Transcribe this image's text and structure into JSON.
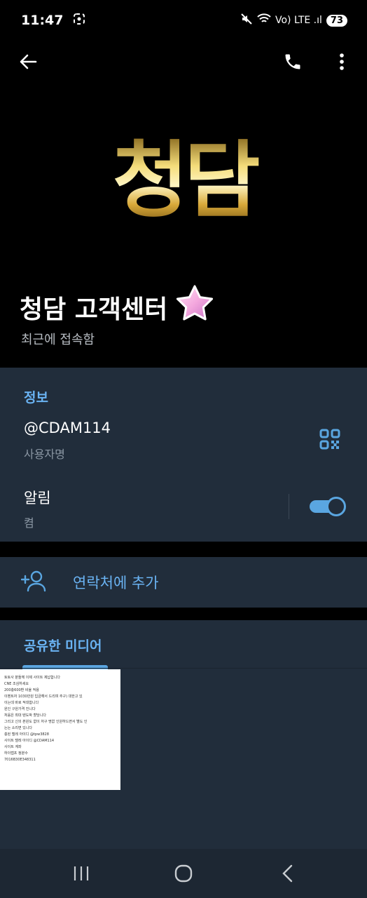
{
  "status_bar": {
    "time": "11:47",
    "network": "Vo) LTE .ıl",
    "battery": "73"
  },
  "icons": {
    "back": "arrow-left-icon",
    "call": "phone-icon",
    "menu": "more-vertical-icon",
    "fab": "message-icon",
    "qr": "qr-code-icon",
    "add_contact": "person-add-icon"
  },
  "hero": {
    "logo_text": "청담"
  },
  "profile": {
    "name": "청담 고객센터",
    "status": "최근에 접속함"
  },
  "info": {
    "title": "정보",
    "username": "@CDAM114",
    "username_caption": "사용자명",
    "notifications_label": "알림",
    "notifications_value": "켬",
    "notifications_on": true
  },
  "add_contact": {
    "label": "연락처에 추가"
  },
  "media": {
    "title": "공유한 미디어",
    "thumbnail_lines": [
      "토토사 분들께 이제 사이트 제납합니다",
      "CNE 조심하세요",
      "200충600환 비율 적용",
      "이벤트자 1030만원 입금해서 드리며 추구) 대한고 있",
      "이는데 바로 적대합니다",
      "원인 구원가격 진니다",
      "처음은 최대 텐도박 할당니다",
      "그리고 신의 본원도 없이 처구 명없 인원하드면서 별도 인",
      "는는 소리면 있니다",
      "충된 텔레 아이디 @tpw3828",
      "사이트 텔레 아이디 @CDAM114",
      "사이트 계좌",
      "하이랩프 정분수",
      "7016B30E348311"
    ]
  },
  "colors": {
    "accent": "#5aa6e1",
    "accent_text": "#6ab3f3",
    "section_bg": "#212d3b",
    "background": "#000000"
  }
}
